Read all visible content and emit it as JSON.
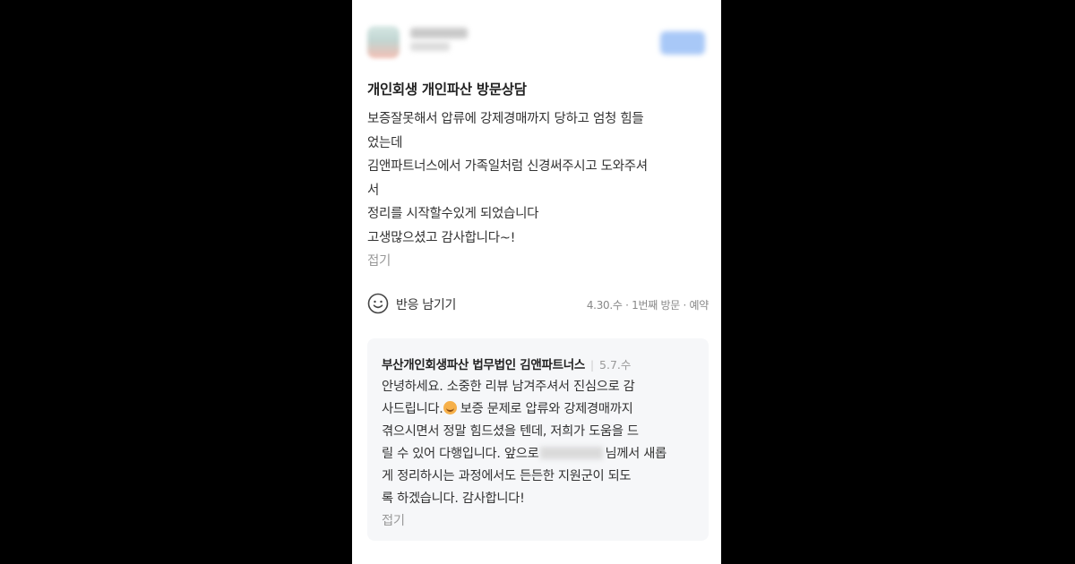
{
  "review": {
    "title": "개인회생 개인파산 방문상담",
    "lines": [
      "보증잘못해서 압류에 강제경매까지 당하고 엄청 힘들",
      "었는데",
      "김앤파트너스에서 가족일처럼 신경써주시고 도와주셔",
      "서",
      "정리를 시작할수있게 되었습니다",
      "고생많으셨고 감사합니다~!"
    ],
    "fold_label": "접기",
    "react_label": "반응 남기기",
    "meta": "4.30.수 · 1번째 방문 · 예약"
  },
  "reply": {
    "name": "부산개인회생파산 법무법인 김앤파트너스",
    "date": "5.7.수",
    "line1": "안녕하세요. 소중한 리뷰 남겨주셔서 진심으로 감",
    "line2_a": "사드립니다.",
    "line2_b": " 보증 문제로 압류와 강제경매까지",
    "line3": "겪으시면서 정말 힘드셨을 텐데, 저희가 도움을 드",
    "line4_a": "릴 수 있어 다행입니다. 앞으로",
    "line4_b": "님께서 새롭",
    "line5": "게 정리하시는 과정에서도 든든한 지원군이 되도",
    "line6": "록 하겠습니다. 감사합니다!",
    "fold_label": "접기"
  }
}
